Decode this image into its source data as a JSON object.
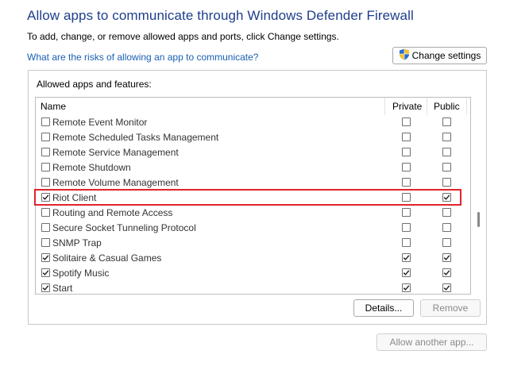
{
  "header": {
    "title": "Allow apps to communicate through Windows Defender Firewall",
    "subtitle": "To add, change, or remove allowed apps and ports, click Change settings.",
    "risk_link": "What are the risks of allowing an app to communicate?",
    "change_settings": "Change settings"
  },
  "group": {
    "label": "Allowed apps and features:",
    "columns": {
      "name": "Name",
      "private": "Private",
      "public": "Public"
    },
    "rows": [
      {
        "name": "Remote Event Monitor",
        "enabled": false,
        "private": false,
        "public": false
      },
      {
        "name": "Remote Scheduled Tasks Management",
        "enabled": false,
        "private": false,
        "public": false
      },
      {
        "name": "Remote Service Management",
        "enabled": false,
        "private": false,
        "public": false
      },
      {
        "name": "Remote Shutdown",
        "enabled": false,
        "private": false,
        "public": false
      },
      {
        "name": "Remote Volume Management",
        "enabled": false,
        "private": false,
        "public": false
      },
      {
        "name": "Riot Client",
        "enabled": true,
        "private": false,
        "public": true
      },
      {
        "name": "Routing and Remote Access",
        "enabled": false,
        "private": false,
        "public": false
      },
      {
        "name": "Secure Socket Tunneling Protocol",
        "enabled": false,
        "private": false,
        "public": false
      },
      {
        "name": "SNMP Trap",
        "enabled": false,
        "private": false,
        "public": false
      },
      {
        "name": "Solitaire & Casual Games",
        "enabled": true,
        "private": true,
        "public": true
      },
      {
        "name": "Spotify Music",
        "enabled": true,
        "private": true,
        "public": true
      },
      {
        "name": "Start",
        "enabled": true,
        "private": true,
        "public": true
      }
    ],
    "details_button": "Details...",
    "remove_button": "Remove"
  },
  "footer": {
    "allow_another_button": "Allow another app..."
  },
  "colors": {
    "title": "#1e3e8c",
    "link": "#1a5fb4",
    "highlight": "#e0242b"
  }
}
